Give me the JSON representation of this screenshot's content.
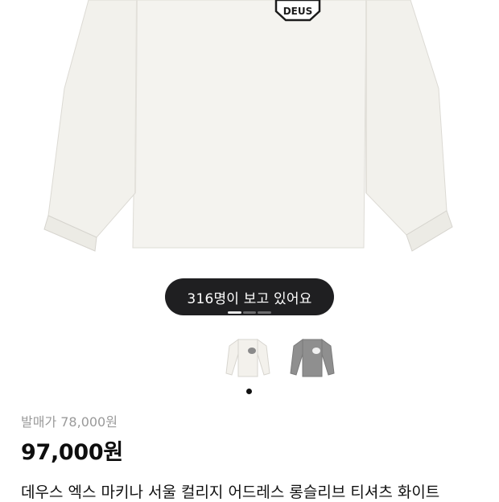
{
  "product_image": {
    "logo_text": "DEUS",
    "variants": [
      {
        "color": "#f3f1ec",
        "name": "white"
      },
      {
        "color": "#8f8f8f",
        "name": "grey"
      }
    ],
    "current_slide": 1,
    "total_slides": 3
  },
  "viewers": {
    "text": "316명이 보고 있어요"
  },
  "pricing": {
    "original_price": "발매가 78,000원",
    "price": "97,000원"
  },
  "product": {
    "title": "데우스 엑스 마키나 서울 컬리지 어드레스 롱슬리브 티셔츠 화이트"
  }
}
